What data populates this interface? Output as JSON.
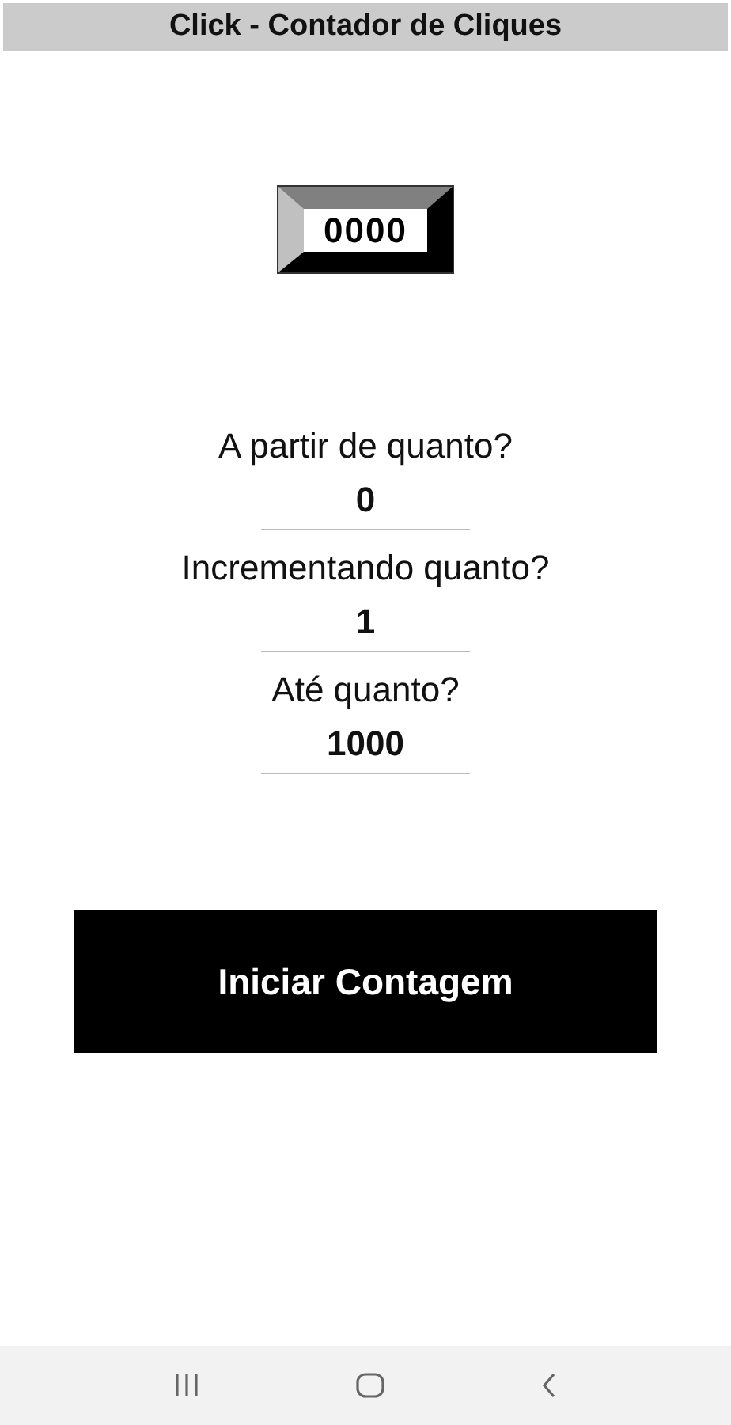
{
  "title": "Click - Contador de Cliques",
  "counter": "0000",
  "fields": [
    {
      "label": "A partir de quanto?",
      "value": "0"
    },
    {
      "label": "Incrementando quanto?",
      "value": "1"
    },
    {
      "label": "Até quanto?",
      "value": "1000"
    }
  ],
  "start_button": "Iniciar Contagem"
}
